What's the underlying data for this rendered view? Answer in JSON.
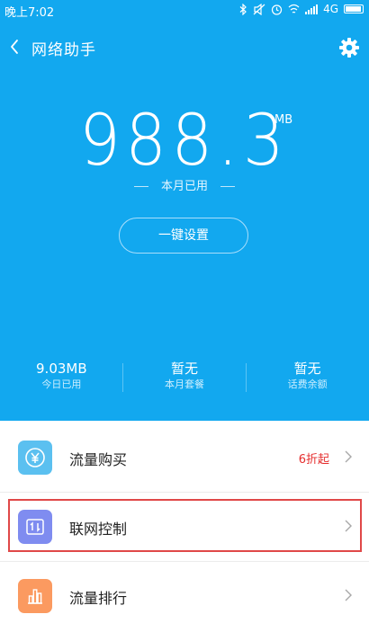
{
  "status_bar": {
    "time": "晚上7:02",
    "network": "4G"
  },
  "header": {
    "title": "网络助手"
  },
  "usage": {
    "value": "988.3",
    "unit": "MB",
    "caption": "本月已用"
  },
  "setup_button": {
    "label": "一键设置"
  },
  "stats": [
    {
      "value": "9.03MB",
      "label": "今日已用"
    },
    {
      "value": "暂无",
      "label": "本月套餐"
    },
    {
      "value": "暂无",
      "label": "话费余额"
    }
  ],
  "list": [
    {
      "label": "流量购买",
      "badge": "6折起",
      "icon": "yen-icon",
      "color": "#5bc0f0"
    },
    {
      "label": "联网控制",
      "badge": "",
      "icon": "network-toggle-icon",
      "color": "#7f8cf0"
    },
    {
      "label": "流量排行",
      "badge": "",
      "icon": "bar-chart-icon",
      "color": "#fb9a60"
    }
  ],
  "colors": {
    "primary": "#12a8ef",
    "highlight": "#e04848",
    "badge": "#e52d2d"
  }
}
